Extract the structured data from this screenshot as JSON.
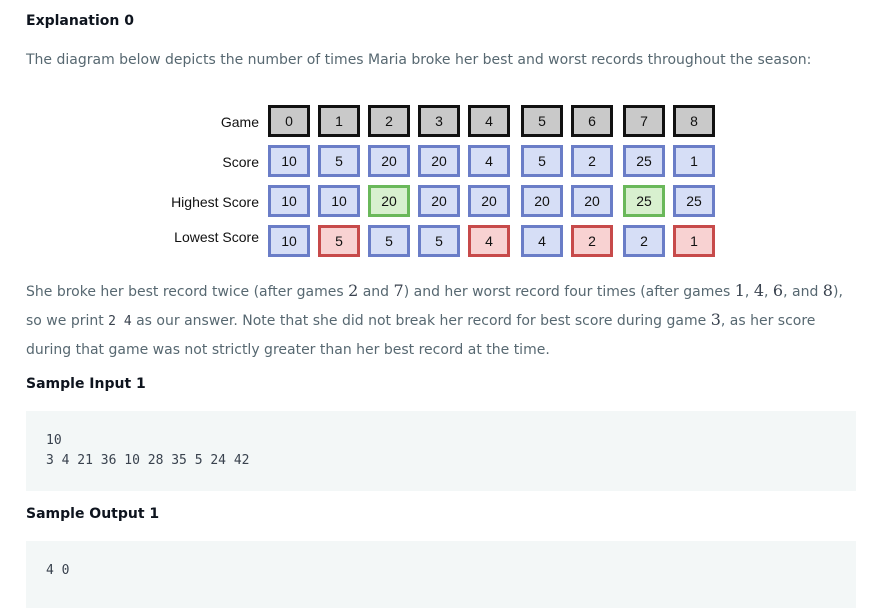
{
  "heading_explanation": "Explanation 0",
  "intro": "The diagram below depicts the number of times Maria broke her best and worst records throughout the season:",
  "diagram": {
    "row_labels": [
      "Game",
      "Score",
      "Highest Score",
      "Lowest Score"
    ],
    "games": [
      "0",
      "1",
      "2",
      "3",
      "4",
      "5",
      "6",
      "7",
      "8"
    ],
    "scores": [
      "10",
      "5",
      "20",
      "20",
      "4",
      "5",
      "2",
      "25",
      "1"
    ],
    "highest": [
      "10",
      "10",
      "20",
      "20",
      "20",
      "20",
      "20",
      "25",
      "25"
    ],
    "lowest": [
      "10",
      "5",
      "5",
      "5",
      "4",
      "4",
      "2",
      "2",
      "1"
    ],
    "highest_broken": [
      2,
      7
    ],
    "lowest_broken": [
      1,
      4,
      6,
      8
    ],
    "colors": {
      "game_fill": "#c9c9c9",
      "game_border": "#111111",
      "normal_fill": "#d6def6",
      "normal_border": "#6a7dc7",
      "best_fill": "#d8f0cf",
      "best_border": "#6ab85a",
      "worst_fill": "#f8d2d2",
      "worst_border": "#c74a4a"
    }
  },
  "para": {
    "t1": "She broke her best record twice (after games ",
    "m1": "2",
    "t2": " and ",
    "m2": "7",
    "t3": ") and her worst record four times (after games ",
    "m3": "1",
    "t4": ", ",
    "m4": "4",
    "t5": ", ",
    "m5": "6",
    "t6": ", and ",
    "m6": "8",
    "t7": "), so we print ",
    "code": "2 4",
    "t8": " as our answer. Note that she did not break her record for best score during game ",
    "m7": "3",
    "t9": ", as her score during that game was not strictly greater than her best record at the time."
  },
  "sample_input_heading": "Sample Input 1",
  "sample_input": "10\n3 4 21 36 10 28 35 5 24 42",
  "sample_output_heading": "Sample Output 1",
  "sample_output": "4 0"
}
